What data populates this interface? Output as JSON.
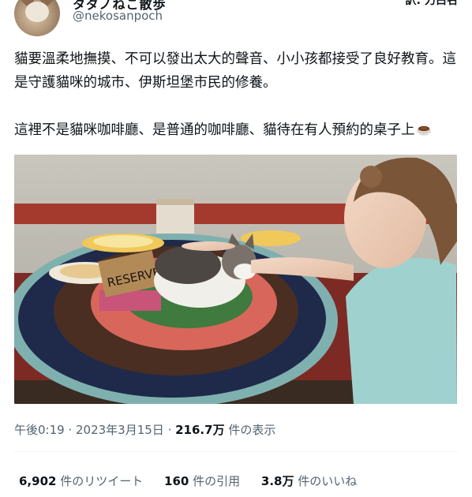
{
  "author": {
    "display_name": "タダノねこ散歩",
    "handle": "@nekosanpoch"
  },
  "header": {
    "translate_label": "訳: 力白名"
  },
  "tweet": {
    "line1": "貓要溫柔地撫摸、不可以發出太大的聲音、小小孩都接受了良好教育。這是守護貓咪的城市、伊斯坦堡市民的修養。",
    "line2": "這裡不是貓咪咖啡廳、是普通的咖啡廳、貓待在有人預約的桌子上",
    "emoji": "coffee-icon"
  },
  "photo": {
    "sign_text": "RESERVE"
  },
  "meta": {
    "time": "午後0:19",
    "sep1": " · ",
    "date": "2023年3月15日",
    "sep2": " · ",
    "views_count": "216.7万",
    "views_label": " 件の表示"
  },
  "stats": {
    "retweets_count": "6,902",
    "retweets_label": " 件のリツイート",
    "quotes_count": "160",
    "quotes_label": " 件の引用",
    "likes_count": "3.8万",
    "likes_label": " 件のいいね"
  },
  "colors": {
    "text": "#0f1419",
    "secondary": "#536471",
    "divider": "#eff3f4"
  }
}
